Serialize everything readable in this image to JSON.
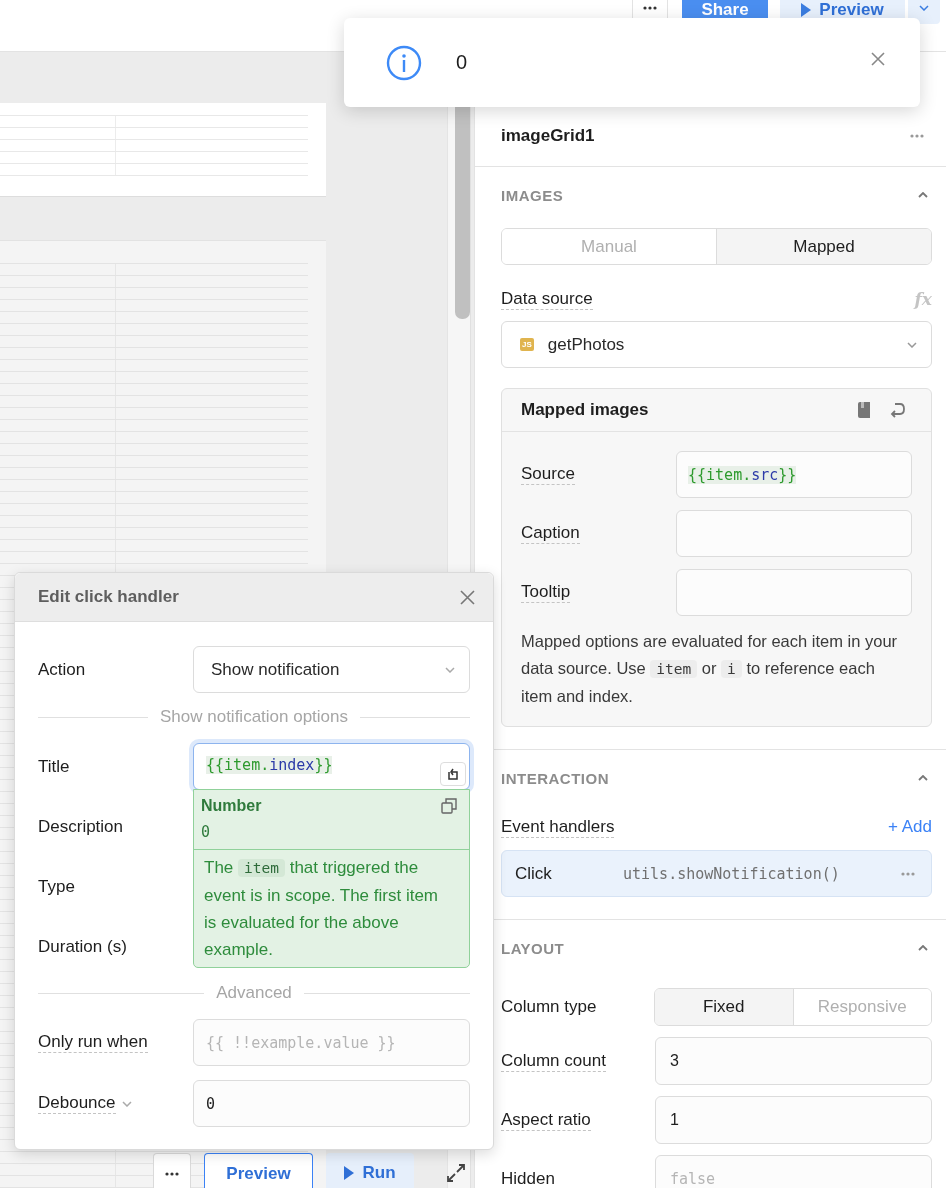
{
  "top_bar": {
    "buttons": [
      {
        "kind": "more"
      },
      {
        "kind": "primary",
        "label": "Share"
      },
      {
        "kind": "play",
        "label": "Preview"
      },
      {
        "kind": "caret"
      }
    ]
  },
  "toast": {
    "message": "0"
  },
  "inspector": {
    "title": "imageGrid1",
    "images": {
      "heading": "IMAGES",
      "expanded": true,
      "modes": [
        {
          "label": "Manual",
          "selected": false
        },
        {
          "label": "Mapped",
          "selected": true
        }
      ],
      "data_source": {
        "label": "Data source",
        "formula": "fx",
        "badge": "JS",
        "value": "getPhotos"
      },
      "mapped_images": {
        "title": "Mapped images",
        "fields": [
          {
            "label": "Source",
            "value": "{{item.src}}"
          },
          {
            "label": "Caption"
          },
          {
            "label": "Tooltip"
          }
        ],
        "help": [
          {
            "kind": "text",
            "text": "Mapped options are evaluated for each item in your data source. Use "
          },
          {
            "kind": "code",
            "text": "item"
          },
          {
            "kind": "text",
            "text": " or "
          },
          {
            "kind": "code",
            "text": "i"
          },
          {
            "kind": "text",
            "text": " to reference each item and index."
          }
        ]
      }
    },
    "interaction": {
      "heading": "INTERACTION",
      "expanded": true,
      "label": "Event handlers",
      "add": "+ Add",
      "handlers": [
        {
          "event": "Click",
          "action": "utils.showNotification()"
        }
      ]
    },
    "layout": {
      "heading": "LAYOUT",
      "expanded": true,
      "column_type": {
        "label": "Column type",
        "options": [
          {
            "label": "Fixed",
            "selected": true
          },
          {
            "label": "Responsive",
            "selected": false
          }
        ]
      },
      "fields": [
        {
          "label": "Column count",
          "value": "3"
        },
        {
          "label": "Aspect ratio",
          "value": "1"
        },
        {
          "label": "Hidden",
          "placeholder": "false"
        }
      ]
    }
  },
  "modal": {
    "title": "Edit click handler",
    "action": {
      "label": "Action",
      "value": "Show notification"
    },
    "options_divider": "Show notification options",
    "fields": [
      {
        "label": "Title",
        "value": "{{item.index}}",
        "focused": true
      },
      {
        "label": "Description"
      },
      {
        "label": "Type"
      },
      {
        "label": "Duration (s)"
      }
    ],
    "preview": {
      "type": "Number",
      "value": "0",
      "note": [
        {
          "kind": "text",
          "text": "The "
        },
        {
          "kind": "code",
          "text": "item"
        },
        {
          "kind": "text",
          "text": " that triggered the event is in scope. The first item is evaluated for the above example."
        }
      ]
    },
    "advanced_divider": "Advanced",
    "only_run_when": {
      "label": "Only run when",
      "placeholder": "{{ !!example.value }}"
    },
    "debounce": {
      "label": "Debounce",
      "value": "0"
    }
  },
  "canvas_toolbar": {
    "buttons": [
      {
        "kind": "more"
      },
      {
        "kind": "outline",
        "label": "Preview"
      },
      {
        "kind": "run",
        "label": "Run"
      },
      {
        "kind": "expand"
      }
    ]
  }
}
